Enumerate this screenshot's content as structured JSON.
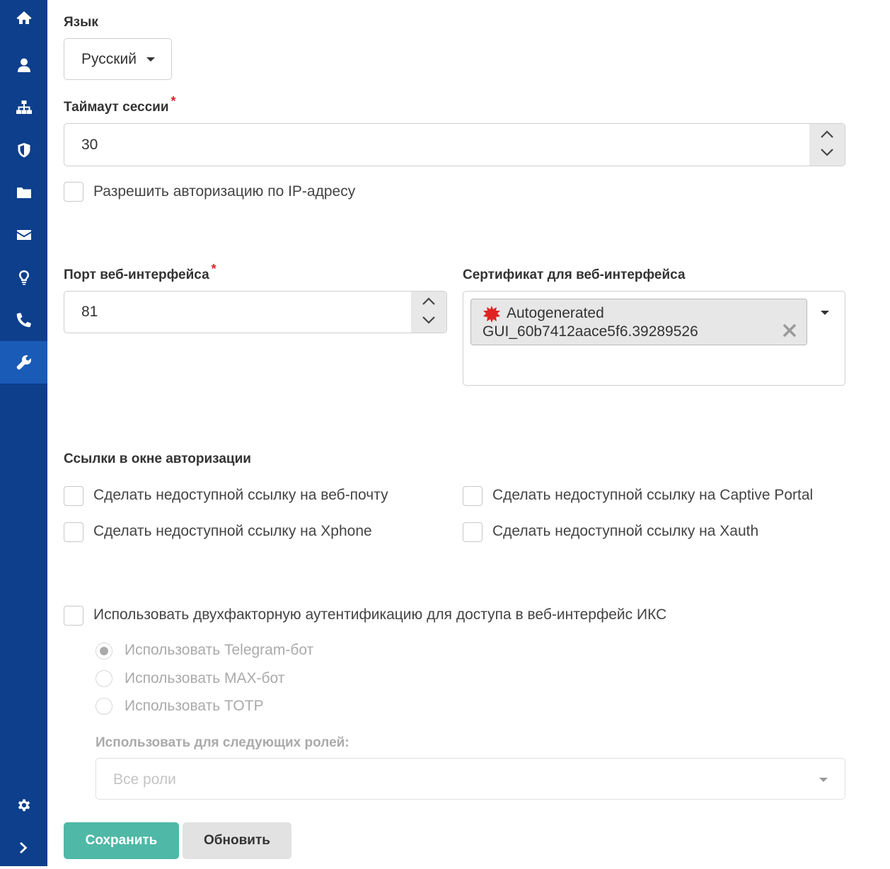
{
  "sidebar": {
    "items": [
      {
        "icon": "home-icon"
      },
      {
        "icon": "user-icon"
      },
      {
        "icon": "sitemap-icon"
      },
      {
        "icon": "shield-icon"
      },
      {
        "icon": "folder-icon"
      },
      {
        "icon": "envelope-icon"
      },
      {
        "icon": "lightbulb-icon"
      },
      {
        "icon": "phone-icon"
      },
      {
        "icon": "wrench-icon",
        "active": true
      }
    ],
    "bottom": [
      {
        "icon": "gear-icon"
      },
      {
        "icon": "chevron-right-icon"
      }
    ]
  },
  "form": {
    "language": {
      "label": "Язык",
      "value": "Русский"
    },
    "session_timeout": {
      "label": "Таймаут сессии",
      "required_mark": "*",
      "value": "30"
    },
    "allow_ip_auth": {
      "label": "Разрешить авторизацию по IP-адресу",
      "checked": false
    },
    "web_port": {
      "label": "Порт веб-интерфейса",
      "required_mark": "*",
      "value": "81"
    },
    "certificate": {
      "label": "Сертификат для веб-интерфейса",
      "selected_line1": "Autogenerated",
      "selected_line2": "GUI_60b7412aace5f6.39289526",
      "remove_symbol": "✖"
    },
    "auth_links": {
      "title": "Ссылки в окне авторизации",
      "options": [
        {
          "label": "Сделать недоступной ссылку на веб-почту",
          "checked": false
        },
        {
          "label": "Сделать недоступной ссылку на Captive Portal",
          "checked": false
        },
        {
          "label": "Сделать недоступной ссылку на Xphone",
          "checked": false
        },
        {
          "label": "Сделать недоступной ссылку на Xauth",
          "checked": false
        }
      ]
    },
    "two_factor": {
      "label": "Использовать двухфакторную аутентификацию для доступа в веб-интерфейс ИКС",
      "checked": false,
      "methods": [
        {
          "label": "Использовать Telegram-бот",
          "selected": true
        },
        {
          "label": "Использовать MAX-бот",
          "selected": false
        },
        {
          "label": "Использовать TOTP",
          "selected": false
        }
      ],
      "roles_label": "Использовать для следующих ролей:",
      "roles_placeholder": "Все роли"
    }
  },
  "buttons": {
    "save": "Сохранить",
    "refresh": "Обновить"
  },
  "colors": {
    "sidebar": "#0d3f8c",
    "sidebar_active": "#1a5bb8",
    "save_button": "#4fb8a6",
    "required": "#d9262c",
    "cert_icon": "#e02424"
  }
}
